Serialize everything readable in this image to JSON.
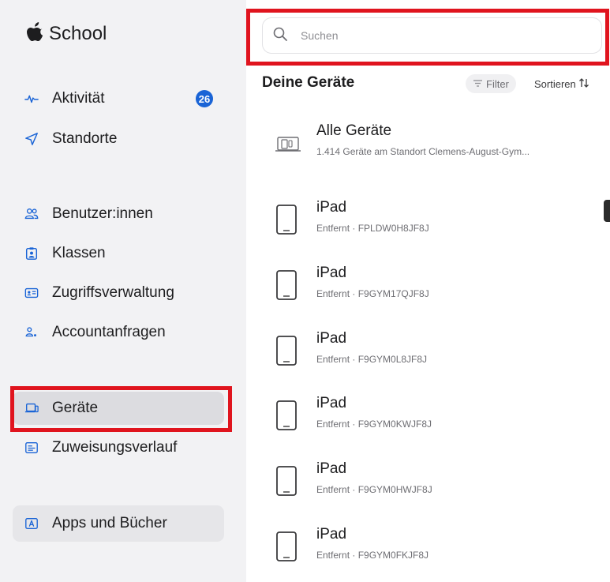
{
  "app": {
    "name": "School"
  },
  "sidebar": {
    "badge_activity": "26",
    "items": [
      {
        "id": "aktivitaet",
        "label": "Aktivität",
        "icon": "activity-icon"
      },
      {
        "id": "standorte",
        "label": "Standorte",
        "icon": "location-arrow-icon"
      },
      {
        "id": "benutzer",
        "label": "Benutzer:innen",
        "icon": "users-icon"
      },
      {
        "id": "klassen",
        "label": "Klassen",
        "icon": "class-icon"
      },
      {
        "id": "zugriff",
        "label": "Zugriffsverwaltung",
        "icon": "id-card-icon"
      },
      {
        "id": "accountanfragen",
        "label": "Accountanfragen",
        "icon": "account-request-icon"
      },
      {
        "id": "geraete",
        "label": "Geräte",
        "icon": "devices-icon",
        "selected": true
      },
      {
        "id": "zuweisung",
        "label": "Zuweisungsverlauf",
        "icon": "list-icon"
      },
      {
        "id": "apps",
        "label": "Apps und Bücher",
        "icon": "apps-icon"
      }
    ]
  },
  "search": {
    "placeholder": "Suchen"
  },
  "devices": {
    "title": "Deine Geräte",
    "filter_label": "Filter",
    "sort_label": "Sortieren",
    "all": {
      "title": "Alle Geräte",
      "subtitle": "1.414 Geräte am Standort Clemens-August-Gym..."
    },
    "rows": [
      {
        "title": "iPad",
        "subtitle": "Entfernt · FPLDW0H8JF8J"
      },
      {
        "title": "iPad",
        "subtitle": "Entfernt · F9GYM17QJF8J"
      },
      {
        "title": "iPad",
        "subtitle": "Entfernt · F9GYM0L8JF8J"
      },
      {
        "title": "iPad",
        "subtitle": "Entfernt · F9GYM0KWJF8J"
      },
      {
        "title": "iPad",
        "subtitle": "Entfernt · F9GYM0HWJF8J"
      },
      {
        "title": "iPad",
        "subtitle": "Entfernt · F9GYM0FKJF8J"
      }
    ]
  },
  "colors": {
    "accent": "#1a64d6",
    "highlight": "#e0141e",
    "sidebar_bg": "#f2f2f4"
  }
}
